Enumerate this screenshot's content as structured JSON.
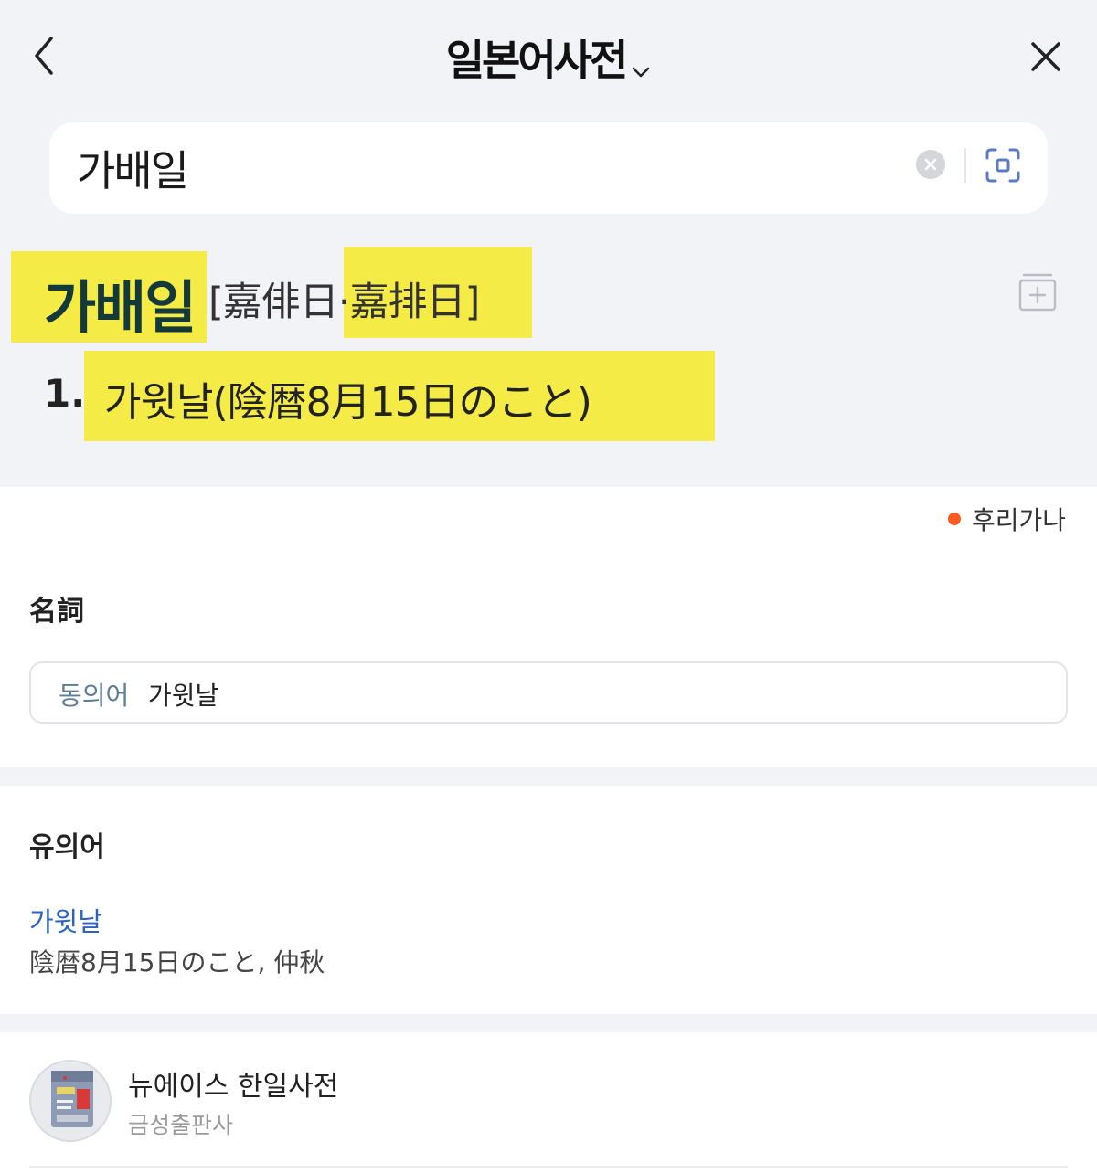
{
  "header": {
    "title": "일본어사전"
  },
  "search": {
    "value": "가배일"
  },
  "entry": {
    "headword": "가배일",
    "hanja": "[嘉俳日·嘉排日]",
    "sense_number": "1.",
    "meaning": "가윗날(陰暦8月15日のこと)"
  },
  "furigana_label": "후리가나",
  "part_of_speech": "名詞",
  "synonym": {
    "label": "동의어",
    "value": "가윗날"
  },
  "similar": {
    "title": "유의어",
    "word": "가윗날",
    "description": "陰暦8月15日のこと, 仲秋"
  },
  "dictionary": {
    "name": "뉴에이스 한일사전",
    "publisher": "금성출판사"
  },
  "colors": {
    "highlight": "#f4eb46",
    "headword": "#14393a",
    "link": "#2a62c8",
    "furigana_dot": "#ff5a1f",
    "top_background": "#f2f3f6"
  }
}
